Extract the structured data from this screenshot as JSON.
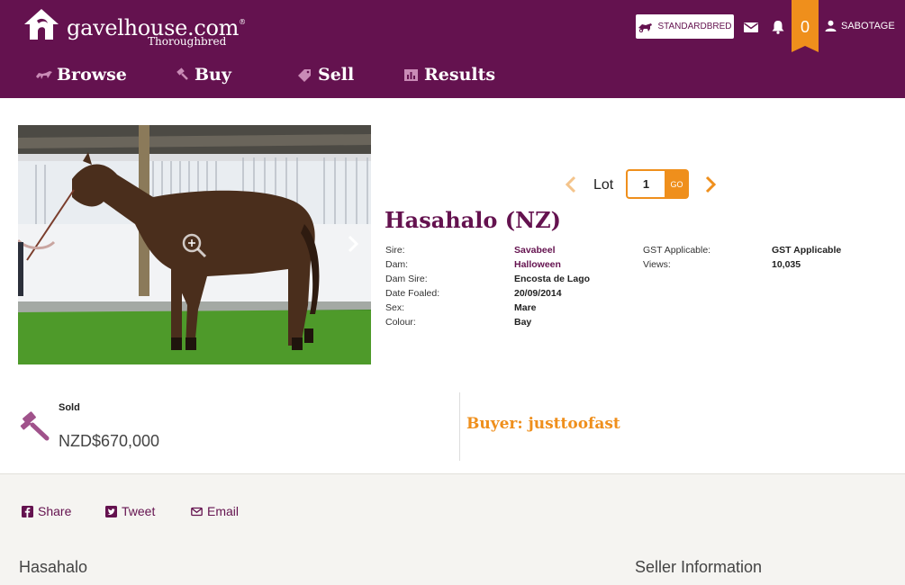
{
  "header": {
    "logo": {
      "name": "gavelhouse.com",
      "trademark": "®",
      "subtitle": "Thoroughbred"
    },
    "standardbred_button": "STANDARDBRED",
    "cart_count": "0",
    "username": "SABOTAGE",
    "icons": [
      "mail-icon",
      "bell-icon",
      "user-icon",
      "trotter-icon"
    ]
  },
  "nav": [
    {
      "label": "Browse",
      "icon": "horse-icon"
    },
    {
      "label": "Buy",
      "icon": "gavel-icon"
    },
    {
      "label": "Sell",
      "icon": "tag-icon"
    },
    {
      "label": "Results",
      "icon": "bar-chart-icon"
    }
  ],
  "lot": {
    "label": "Lot",
    "value": "1",
    "go": "GO"
  },
  "horse": {
    "name": "Hasahalo (NZ)",
    "details_left": [
      {
        "label": "Sire:",
        "value": "Savabeel",
        "link": true
      },
      {
        "label": "Dam:",
        "value": "Halloween",
        "link": true
      },
      {
        "label": "Dam Sire:",
        "value": "Encosta de Lago",
        "link": false
      },
      {
        "label": "Date Foaled:",
        "value": "20/09/2014",
        "link": false
      },
      {
        "label": "Sex:",
        "value": "Mare",
        "link": false
      },
      {
        "label": "Colour:",
        "value": "Bay",
        "link": false
      }
    ],
    "details_right": [
      {
        "label": "GST Applicable:",
        "value": "GST Applicable"
      },
      {
        "label": "Views:",
        "value": "10,035"
      }
    ]
  },
  "sale": {
    "status": "Sold",
    "price": "NZD$670,000",
    "buyer": "Buyer: justtoofast"
  },
  "share": [
    {
      "label": "Share",
      "icon": "facebook-icon"
    },
    {
      "label": "Tweet",
      "icon": "twitter-icon"
    },
    {
      "label": "Email",
      "icon": "envelope-icon"
    }
  ],
  "sections": {
    "horse_title": "Hasahalo",
    "seller_title": "Seller Information"
  },
  "colors": {
    "brand_purple": "#64124f",
    "accent_orange": "#ef8f1c",
    "panel_bg": "#f5f4f1"
  }
}
